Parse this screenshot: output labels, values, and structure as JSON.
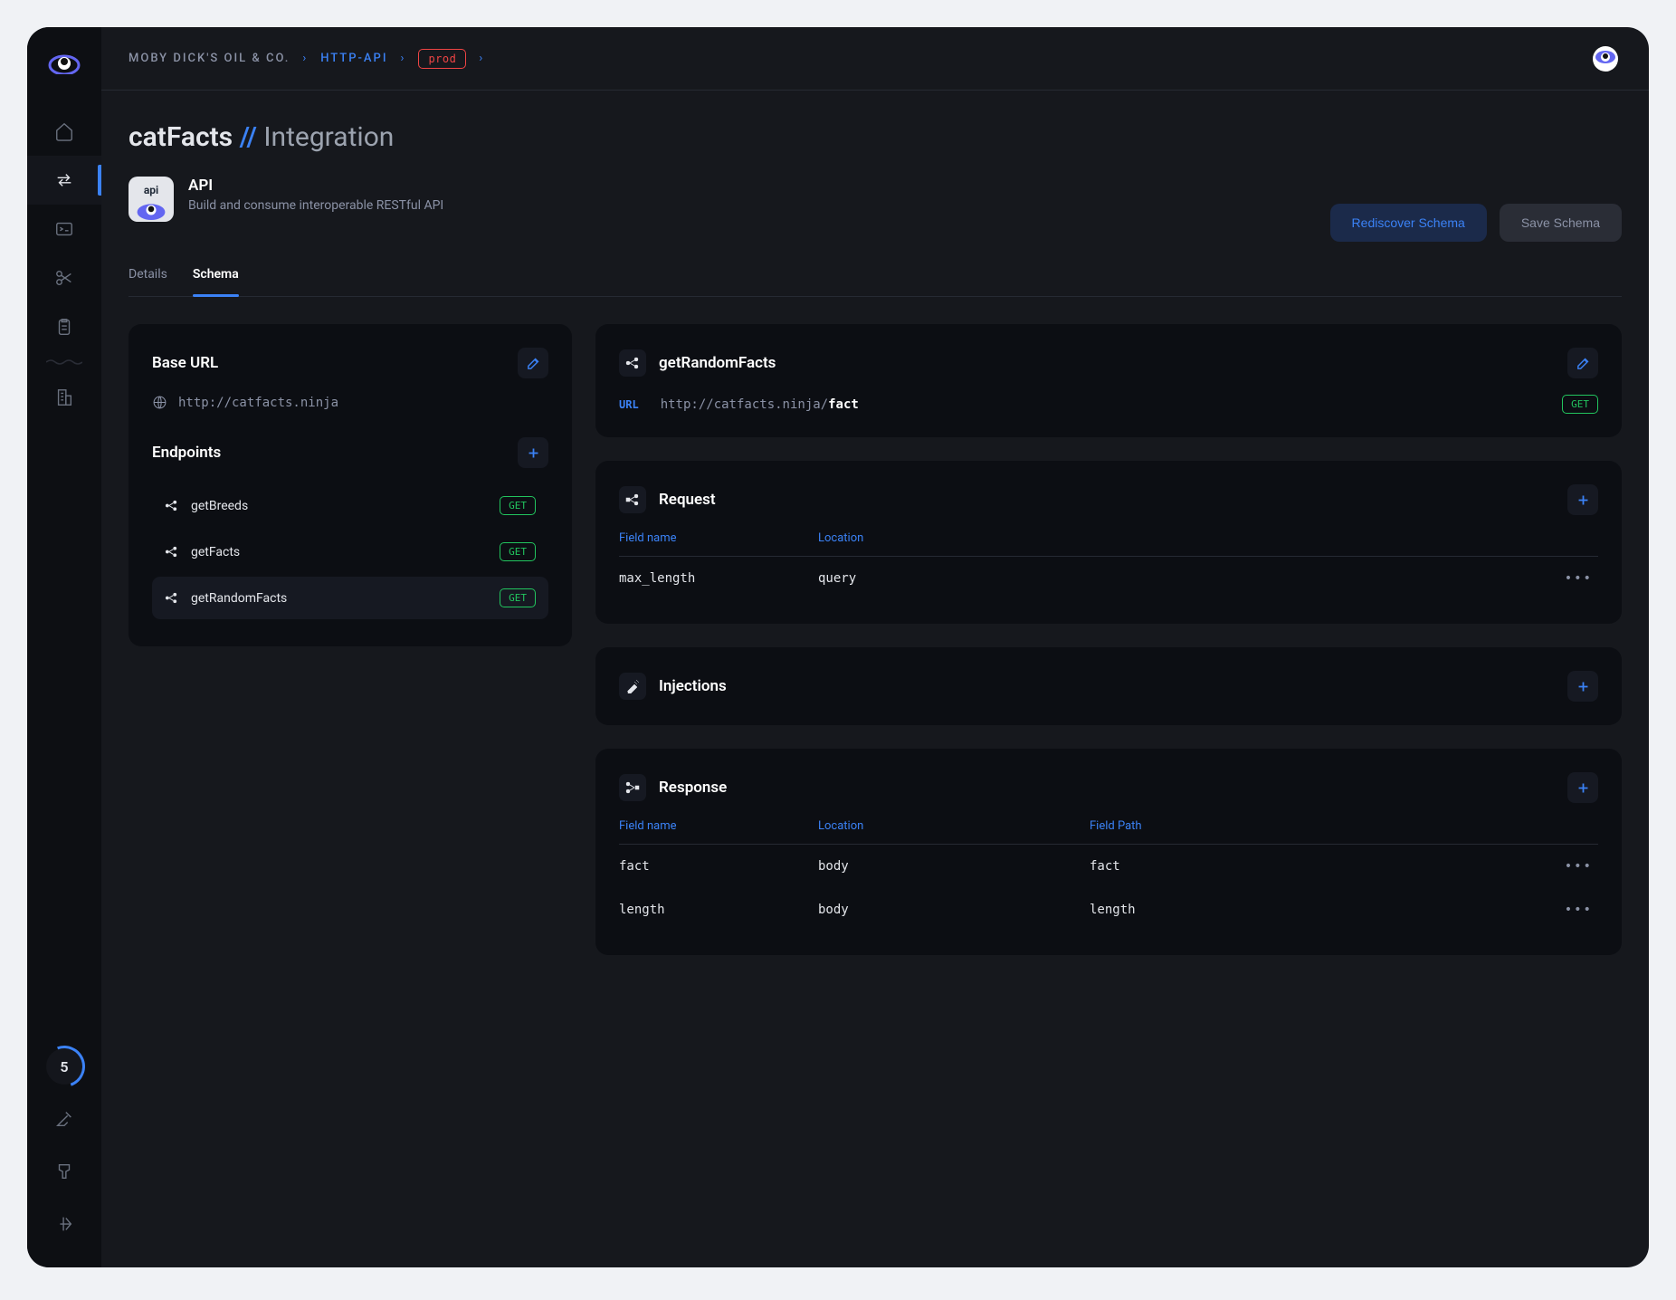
{
  "breadcrumb": {
    "company": "MOBY DICK'S OIL & CO.",
    "api": "HTTP-API",
    "env": "prod"
  },
  "page": {
    "title_main": "catFacts",
    "title_sep": "//",
    "title_sub": "Integration"
  },
  "api_header": {
    "icon_label": "api",
    "title": "API",
    "subtitle": "Build and consume interoperable RESTful API"
  },
  "buttons": {
    "rediscover": "Rediscover Schema",
    "save": "Save Schema"
  },
  "tabs": {
    "details": "Details",
    "schema": "Schema"
  },
  "base_url": {
    "title": "Base URL",
    "value": "http://catfacts.ninja"
  },
  "endpoints": {
    "title": "Endpoints",
    "list": [
      {
        "name": "getBreeds",
        "method": "GET"
      },
      {
        "name": "getFacts",
        "method": "GET"
      },
      {
        "name": "getRandomFacts",
        "method": "GET"
      }
    ]
  },
  "selected_endpoint": {
    "name": "getRandomFacts",
    "url_label": "URL",
    "url_base": "http://catfacts.ninja/",
    "url_path": "fact",
    "method": "GET"
  },
  "request": {
    "title": "Request",
    "headers": {
      "field": "Field name",
      "location": "Location"
    },
    "rows": [
      {
        "field": "max_length",
        "location": "query"
      }
    ]
  },
  "injections": {
    "title": "Injections"
  },
  "response": {
    "title": "Response",
    "headers": {
      "field": "Field name",
      "location": "Location",
      "path": "Field Path"
    },
    "rows": [
      {
        "field": "fact",
        "location": "body",
        "path": "fact"
      },
      {
        "field": "length",
        "location": "body",
        "path": "length"
      }
    ]
  },
  "sidebar_counter": "5"
}
